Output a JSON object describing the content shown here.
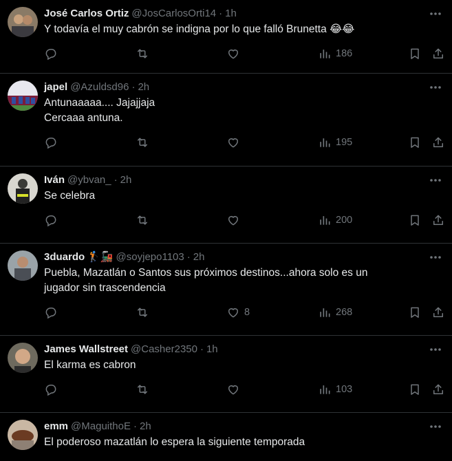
{
  "tweets": [
    {
      "name": "José Carlos Ortiz",
      "handle": "@JosCarlosOrti14",
      "time": "1h",
      "lines": [
        "Y todavía el muy cabrón se indigna por lo que falló Brunetta 😂😂"
      ],
      "likes": "",
      "views": "186"
    },
    {
      "name": "japel",
      "handle": "@Azuldsd96",
      "time": "2h",
      "lines": [
        "Antunaaaaa.... Jajajjaja",
        "Cercaaa antuna."
      ],
      "likes": "",
      "views": "195"
    },
    {
      "name": "Iván",
      "handle": "@ybvan_",
      "time": "2h",
      "lines": [
        "Se celebra"
      ],
      "likes": "",
      "views": "200"
    },
    {
      "name": "3duardo",
      "name_emoji": "🏌🚂",
      "handle": "@soyjepo1103",
      "time": "2h",
      "lines": [
        "Puebla, Mazatlán o Santos sus próximos destinos...ahora solo es un",
        "jugador sin trascendencia"
      ],
      "likes": "8",
      "views": "268"
    },
    {
      "name": "James Wallstreet",
      "handle": "@Casher2350",
      "time": "1h",
      "lines": [
        "El karma es cabron"
      ],
      "likes": "",
      "views": "103"
    },
    {
      "name": "emm",
      "handle": "@MaguithoE",
      "time": "2h",
      "lines": [
        "El poderoso mazatlán lo espera la siguiente temporada"
      ],
      "likes": "",
      "views": ""
    }
  ],
  "separator": "·",
  "icons": [
    "more-icon",
    "reply-icon",
    "retweet-icon",
    "like-icon",
    "views-icon",
    "bookmark-icon",
    "share-icon"
  ],
  "colors": {
    "background": "#000000",
    "text": "#e7e9ea",
    "muted": "#71767b",
    "divider": "#2f3336"
  }
}
